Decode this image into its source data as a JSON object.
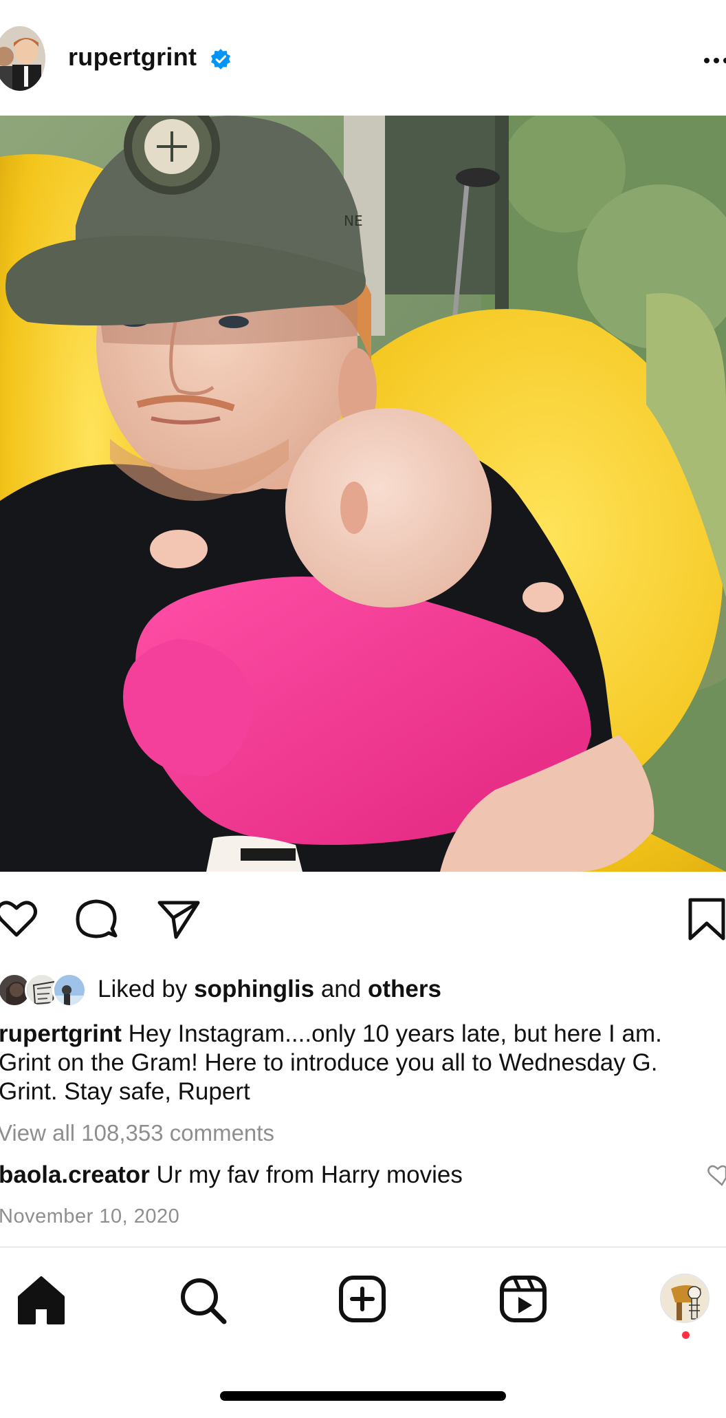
{
  "header": {
    "username": "rupertgrint",
    "verified": true
  },
  "photo": {
    "alt_subject": "selfie-with-baby"
  },
  "actions": {
    "like_icon": "heart-outline-icon",
    "comment_icon": "comment-bubble-icon",
    "share_icon": "paper-plane-icon",
    "save_icon": "bookmark-outline-icon"
  },
  "likes": {
    "prefix": "Liked by ",
    "first_liker": "sophinglis",
    "middle": " and ",
    "others": "others"
  },
  "caption": {
    "username": "rupertgrint",
    "line1": " Hey Instagram....only 10 years late, but here I am.",
    "line2": "Grint on the Gram! Here to introduce you all to Wednesday G.",
    "line3": "Grint. Stay safe, Rupert"
  },
  "comments": {
    "view_all": "View all 108,353 comments",
    "top_comment": {
      "username": "baola.creator",
      "text": " Ur my fav from Harry movies"
    }
  },
  "post_date": "November 10, 2020",
  "bottom_nav": {
    "items": [
      "home-icon",
      "search-icon",
      "create-post-icon",
      "reels-icon",
      "profile-avatar"
    ],
    "notification_dot": true
  },
  "colors": {
    "verified_blue": "#0095f6",
    "text_primary": "#111111",
    "text_secondary": "#8e8e8e",
    "notification_red": "#ff3040",
    "divider": "#dbdbdb"
  }
}
